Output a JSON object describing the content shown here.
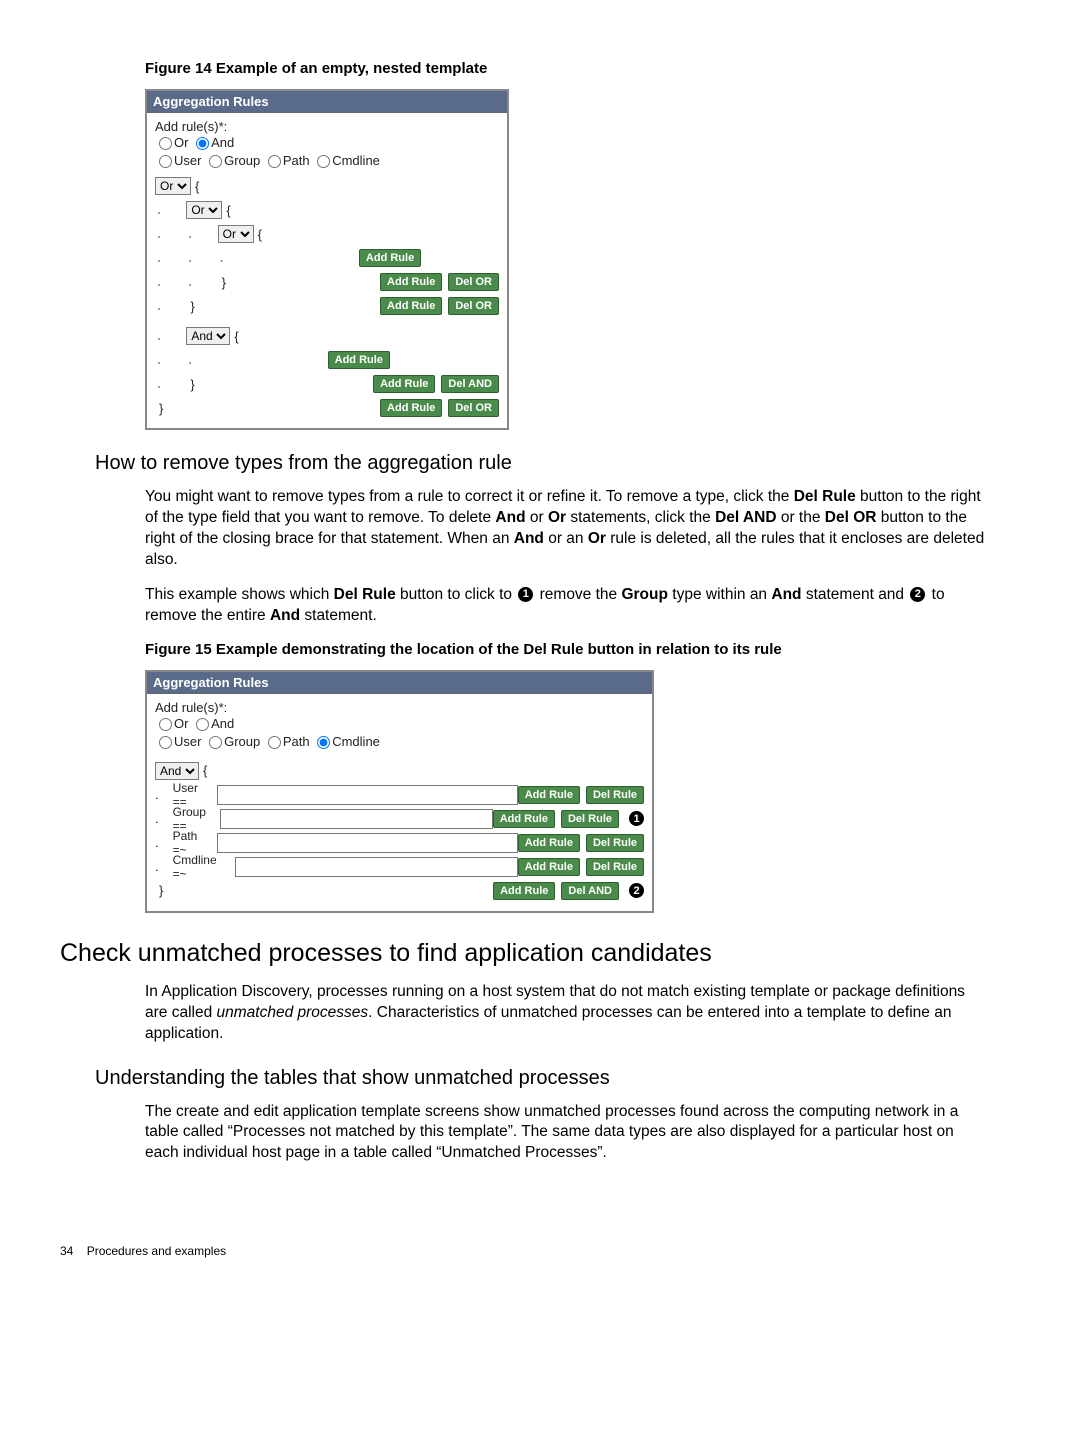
{
  "fig14": {
    "caption": "Figure 14 Example of an empty, nested template",
    "panel_title": "Aggregation Rules",
    "add_rule_label": "Add rule(s)*:",
    "logic": {
      "or": "Or",
      "and": "And"
    },
    "types": {
      "user": "User",
      "group": "Group",
      "path": "Path",
      "cmdline": "Cmdline"
    },
    "sel_or": "Or",
    "sel_and": "And",
    "btn_add": "Add Rule",
    "btn_del_or": "Del OR",
    "btn_del_and": "Del AND"
  },
  "remove": {
    "heading": "How to remove types from the aggregation rule",
    "p1a": "You might want to remove types from a rule to correct it or refine it. To remove a type, click the ",
    "p1b": "Del Rule",
    "p1c": " button to the right of the type field that you want to remove. To delete ",
    "p1d": "And",
    "p1e": " or ",
    "p1f": "Or",
    "p1g": " statements, click the ",
    "p1h": "Del AND",
    "p1i": " or the ",
    "p1j": "Del OR",
    "p1k": " button to the right of the closing brace for that statement. When an ",
    "p1l": "And",
    "p1m": " or an ",
    "p1n": "Or",
    "p1o": " rule is deleted, all the rules that it encloses are deleted also.",
    "p2a": "This example shows which ",
    "p2b": "Del Rule",
    "p2c": " button to click to ",
    "p2d": " remove the ",
    "p2e": "Group",
    "p2f": " type within an ",
    "p2g": "And",
    "p2h": " statement and ",
    "p2i": " to remove the entire ",
    "p2j": "And",
    "p2k": "  statement."
  },
  "fig15": {
    "caption": "Figure 15 Example demonstrating the location of the Del Rule button in relation to its rule",
    "panel_title": "Aggregation Rules",
    "add_rule_label": "Add rule(s)*:",
    "logic": {
      "or": "Or",
      "and": "And"
    },
    "types": {
      "user": "User",
      "group": "Group",
      "path": "Path",
      "cmdline": "Cmdline"
    },
    "sel_and": "And",
    "row_user": "User ==",
    "row_group": "Group ==",
    "row_path": "Path =~",
    "row_cmd": "Cmdline =~",
    "btn_add": "Add Rule",
    "btn_del_rule": "Del Rule",
    "btn_del_and": "Del AND",
    "callout1": "1",
    "callout2": "2"
  },
  "candidates": {
    "heading": "Check unmatched processes to find application candidates",
    "p1a": "In Application Discovery, processes running on a host system that do not match existing template or package definitions are called ",
    "p1b": "unmatched processes",
    "p1c": ". Characteristics of unmatched processes can be entered into a template to define an application."
  },
  "tables": {
    "heading": "Understanding the tables that show unmatched processes",
    "p1": "The create and edit application template screens show unmatched processes found across the computing network in a table called “Processes not matched by this template”. The same data types are also displayed for a particular host on each individual host page in a table called “Unmatched Processes”."
  },
  "footer": {
    "page": "34",
    "section": "Procedures and examples"
  },
  "callouts": {
    "c1": "1",
    "c2": "2"
  }
}
